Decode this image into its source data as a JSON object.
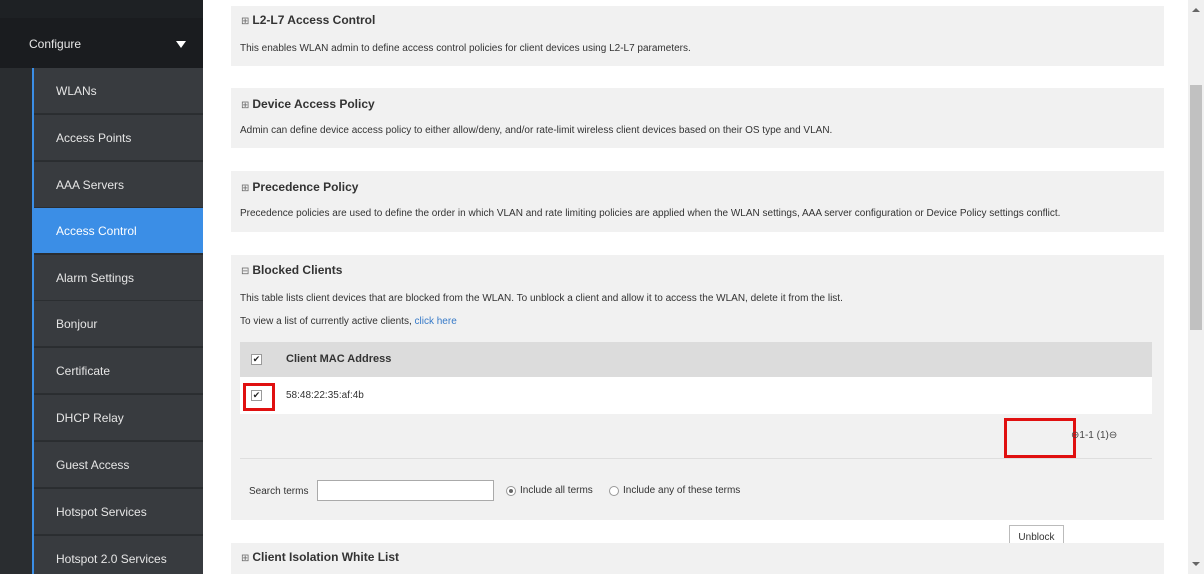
{
  "sidebar": {
    "configure_label": "Configure",
    "items": [
      {
        "label": "WLANs"
      },
      {
        "label": "Access Points"
      },
      {
        "label": "AAA Servers"
      },
      {
        "label": "Access Control"
      },
      {
        "label": "Alarm Settings"
      },
      {
        "label": "Bonjour"
      },
      {
        "label": "Certificate"
      },
      {
        "label": "DHCP Relay"
      },
      {
        "label": "Guest Access"
      },
      {
        "label": "Hotspot Services"
      },
      {
        "label": "Hotspot 2.0 Services"
      }
    ],
    "active_item": "Access Control"
  },
  "sections": {
    "l2l7": {
      "expander": "⊞",
      "title": "L2-L7 Access Control",
      "description": "This enables WLAN admin to define access control policies for client devices using L2-L7 parameters."
    },
    "device_policy": {
      "expander": "⊞",
      "title": "Device Access Policy",
      "description": "Admin can define device access policy to either allow/deny, and/or rate-limit wireless client devices based on their OS type and VLAN."
    },
    "precedence": {
      "expander": "⊞",
      "title": "Precedence Policy",
      "description": "Precedence policies are used to define the order in which VLAN and rate limiting policies are applied when the WLAN settings, AAA server configuration or Device Policy settings conflict."
    },
    "blocked": {
      "expander": "⊟",
      "title": "Blocked Clients",
      "description": "This table lists client devices that are blocked from the WLAN. To unblock a client and allow it to access the WLAN, delete it from the list.",
      "view_text": "To view a list of currently active clients, ",
      "view_link": "click here",
      "table": {
        "column_header": "Client MAC Address",
        "rows": [
          {
            "mac": "58:48:22:35:af:4b",
            "checked": true
          }
        ]
      },
      "unblock_label": "Unblock",
      "pager": "1-1 (1)",
      "search_label": "Search terms",
      "search_value": "",
      "radio_all_label": "Include all terms",
      "radio_any_label": "Include any of these terms",
      "radio_selected": "all"
    },
    "isolation": {
      "expander": "⊞",
      "title": "Client Isolation White List"
    }
  },
  "colors": {
    "accent": "#3b8ee6",
    "highlight": "#e01010"
  }
}
